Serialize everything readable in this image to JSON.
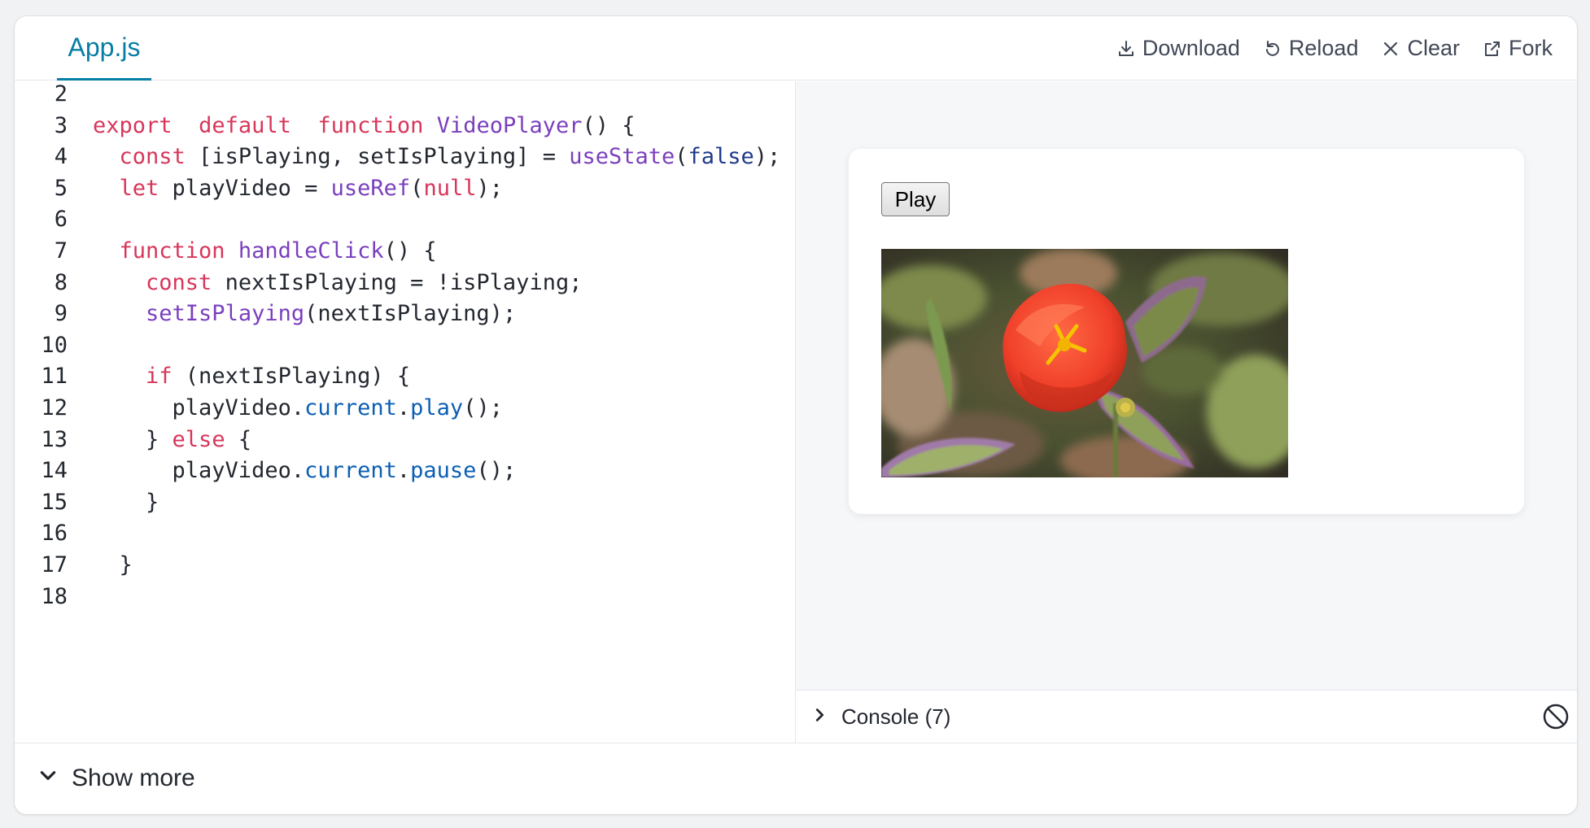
{
  "file_tab": {
    "label": "App.js"
  },
  "actions": {
    "download": {
      "label": "Download",
      "icon": "download-icon"
    },
    "reload": {
      "label": "Reload",
      "icon": "reload-icon"
    },
    "clear": {
      "label": "Clear",
      "icon": "close-icon"
    },
    "fork": {
      "label": "Fork",
      "icon": "external-link-icon"
    }
  },
  "code": {
    "line_numbers": [
      "2",
      "3",
      "4",
      "5",
      "6",
      "7",
      "8",
      "9",
      "10",
      "11",
      "12",
      "13",
      "14",
      "15",
      "16",
      "17",
      "18"
    ],
    "lines": [
      [],
      [
        [
          "kw",
          "export"
        ],
        [
          "",
          "  "
        ],
        [
          "kw",
          "default"
        ],
        [
          "",
          "  "
        ],
        [
          "kw",
          "function"
        ],
        [
          "",
          " "
        ],
        [
          "fn",
          "VideoPlayer"
        ],
        [
          "",
          "() {"
        ]
      ],
      [
        [
          "",
          "  "
        ],
        [
          "kw",
          "const"
        ],
        [
          "",
          " [isPlaying, setIsPlaying] = "
        ],
        [
          "fn",
          "useState"
        ],
        [
          "",
          "("
        ],
        [
          "bl",
          "false"
        ],
        [
          "",
          ");"
        ]
      ],
      [
        [
          "",
          "  "
        ],
        [
          "kw",
          "let"
        ],
        [
          "",
          " playVideo = "
        ],
        [
          "fn",
          "useRef"
        ],
        [
          "",
          "("
        ],
        [
          "kw",
          "null"
        ],
        [
          "",
          ");"
        ]
      ],
      [],
      [
        [
          "",
          "  "
        ],
        [
          "kw",
          "function"
        ],
        [
          "",
          " "
        ],
        [
          "fn",
          "handleClick"
        ],
        [
          "",
          "() {"
        ]
      ],
      [
        [
          "",
          "    "
        ],
        [
          "kw",
          "const"
        ],
        [
          "",
          " nextIsPlaying = !isPlaying;"
        ]
      ],
      [
        [
          "",
          "    "
        ],
        [
          "fn",
          "setIsPlaying"
        ],
        [
          "",
          "(nextIsPlaying);"
        ]
      ],
      [],
      [
        [
          "",
          "    "
        ],
        [
          "kw",
          "if"
        ],
        [
          "",
          " (nextIsPlaying) {"
        ]
      ],
      [
        [
          "",
          "      playVideo."
        ],
        [
          "pr",
          "current"
        ],
        [
          "",
          "."
        ],
        [
          "pr",
          "play"
        ],
        [
          "",
          "();"
        ]
      ],
      [
        [
          "",
          "    } "
        ],
        [
          "kw",
          "else"
        ],
        [
          "",
          " {"
        ]
      ],
      [
        [
          "",
          "      playVideo."
        ],
        [
          "pr",
          "current"
        ],
        [
          "",
          "."
        ],
        [
          "pr",
          "pause"
        ],
        [
          "",
          "();"
        ]
      ],
      [
        [
          "",
          "    }"
        ]
      ],
      [],
      [
        [
          "",
          "  }"
        ]
      ],
      []
    ]
  },
  "preview": {
    "play_button_label": "Play"
  },
  "console": {
    "label": "Console (7)"
  },
  "show_more": {
    "label": "Show more"
  },
  "colors": {
    "accent": "#087ea4",
    "keyword": "#d7365a",
    "function": "#7a3fbd",
    "property": "#0b5fb3"
  }
}
